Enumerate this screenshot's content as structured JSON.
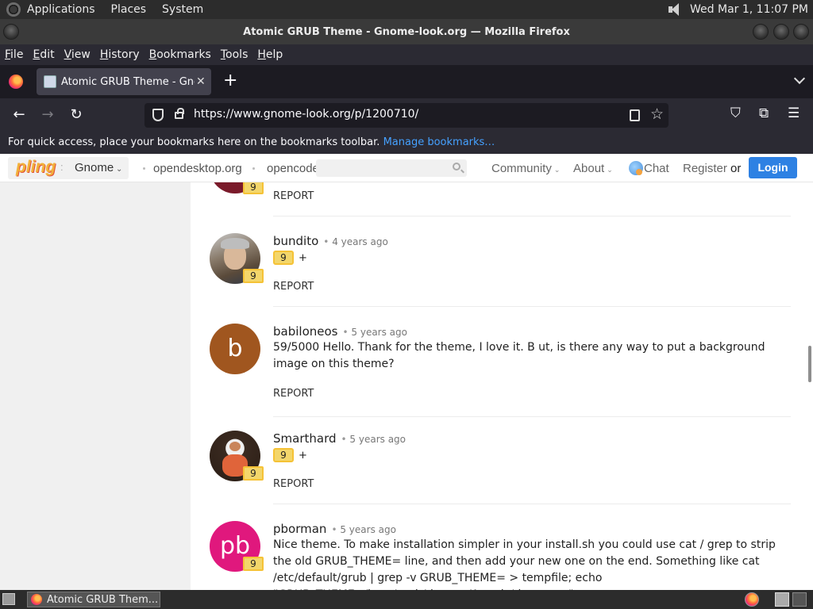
{
  "panel": {
    "applications": "Applications",
    "places": "Places",
    "system": "System",
    "clock": "Wed Mar  1, 11:07 PM"
  },
  "window": {
    "title": "Atomic GRUB Theme - Gnome-look.org — Mozilla Firefox"
  },
  "menubar": [
    "File",
    "Edit",
    "View",
    "History",
    "Bookmarks",
    "Tools",
    "Help"
  ],
  "tab": {
    "title": "Atomic GRUB Theme - Gnome-look.org",
    "close": "✕",
    "new_tab": "+"
  },
  "nav": {
    "back": "←",
    "forward": "→",
    "reload": "↻",
    "url": "https://www.gnome-look.org/p/1200710/"
  },
  "bookmarks_bar": {
    "message": "For quick access, place your bookmarks here on the bookmarks toolbar.",
    "link": "Manage bookmarks…"
  },
  "site_header": {
    "logo": "pling",
    "store": "Gnome",
    "links": [
      "opendesktop.org",
      "opencode"
    ],
    "community": "Community",
    "about": "About",
    "chat": "Chat",
    "register": "Register",
    "or": "or",
    "login": "Login"
  },
  "comments": [
    {
      "score": "9",
      "report": "REPORT"
    },
    {
      "username": "bundito",
      "ago": "4 years ago",
      "score": "9",
      "rating": "9",
      "plus": "+",
      "report": "REPORT"
    },
    {
      "username": "babiloneos",
      "ago": "5 years ago",
      "initials": "b",
      "avatar_color": "#a0561f",
      "text": "59/5000 Hello. Thank for the theme, I love it. B ut, is there any way to put a background image on this theme?",
      "report": "REPORT"
    },
    {
      "username": "Smarthard",
      "ago": "5 years ago",
      "score": "9",
      "rating": "9",
      "plus": "+",
      "report": "REPORT"
    },
    {
      "username": "pborman",
      "ago": "5 years ago",
      "initials": "pb",
      "avatar_color": "#e0187d",
      "score": "9",
      "text": "Nice theme. To make installation simpler in your install.sh you could use cat / grep to strip the old GRUB_THEME= line, and then add your new one on the end. Something like cat /etc/default/grub | grep -v GRUB_THEME= > tempfile; echo \"GRUB_THEME=/boot/grub/themes/Atomic/theme.txt\""
    }
  ],
  "taskbar": {
    "task": "Atomic GRUB Them..."
  }
}
